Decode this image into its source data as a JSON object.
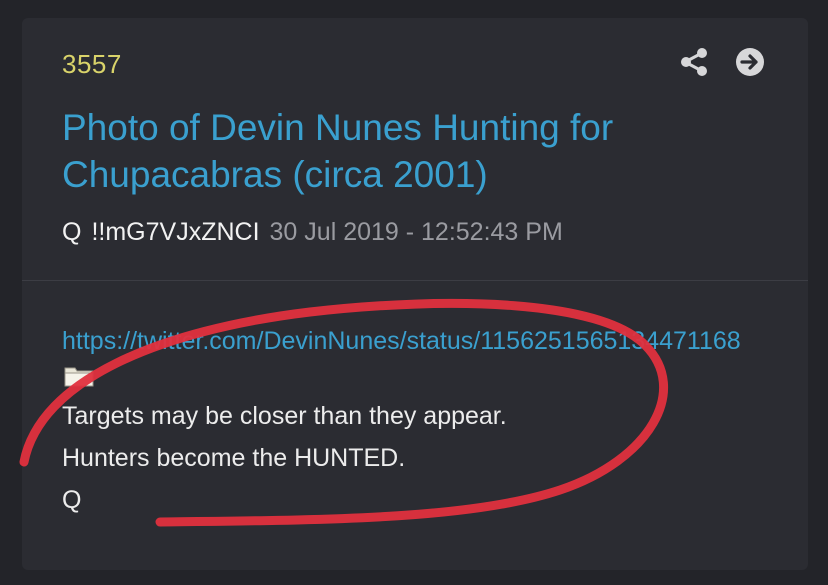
{
  "post": {
    "number": "3557",
    "title": "Photo of Devin Nunes Hunting for Chupacabras (circa 2001)",
    "author": "Q",
    "tripcode": "!!mG7VJxZNCI",
    "timestamp": "30 Jul 2019 - 12:52:43 PM",
    "link": "https://twitter.com/DevinNunes/status/1156251565134471168",
    "lines": [
      "Targets may be closer than they appear.",
      "Hunters become the HUNTED.",
      "Q"
    ]
  },
  "icons": {
    "share": "share-icon",
    "navigate": "arrow-right-circle-icon",
    "attachment": "folder-icon"
  },
  "colors": {
    "background": "#232429",
    "card": "#2b2c32",
    "post_number": "#d9d36a",
    "title": "#3aa0cf",
    "link": "#3aa0cf",
    "timestamp": "#9a9ba1",
    "annotation": "#e0303e"
  }
}
